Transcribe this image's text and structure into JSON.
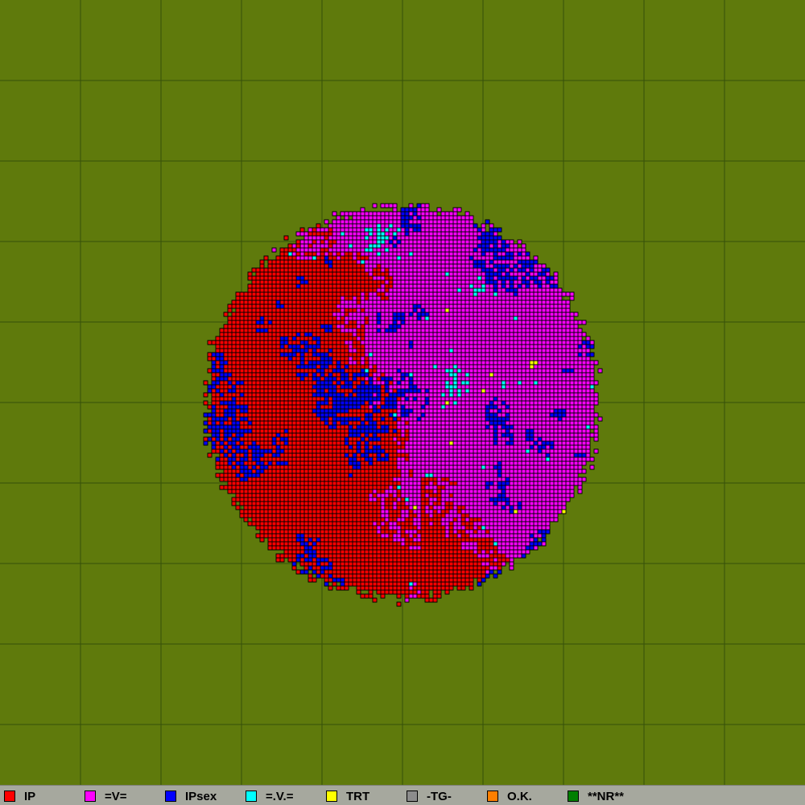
{
  "colors": {
    "background": "#5f7a0c",
    "grid_line": "#36500a",
    "cell_border": "#000000",
    "legend_bar": "#a6a89e"
  },
  "legend": [
    {
      "label": "IP",
      "color": "#ff0000"
    },
    {
      "label": "=V=",
      "color": "#ff00ff"
    },
    {
      "label": "IPsex",
      "color": "#0000ff"
    },
    {
      "label": "=.V.=",
      "color": "#00ffff"
    },
    {
      "label": "TRT",
      "color": "#ffff00"
    },
    {
      "label": "-TG-",
      "color": "#8c8c8c"
    },
    {
      "label": "O.K.",
      "color": "#ff7f00"
    },
    {
      "label": "**NR**",
      "color": "#007f00"
    }
  ]
}
